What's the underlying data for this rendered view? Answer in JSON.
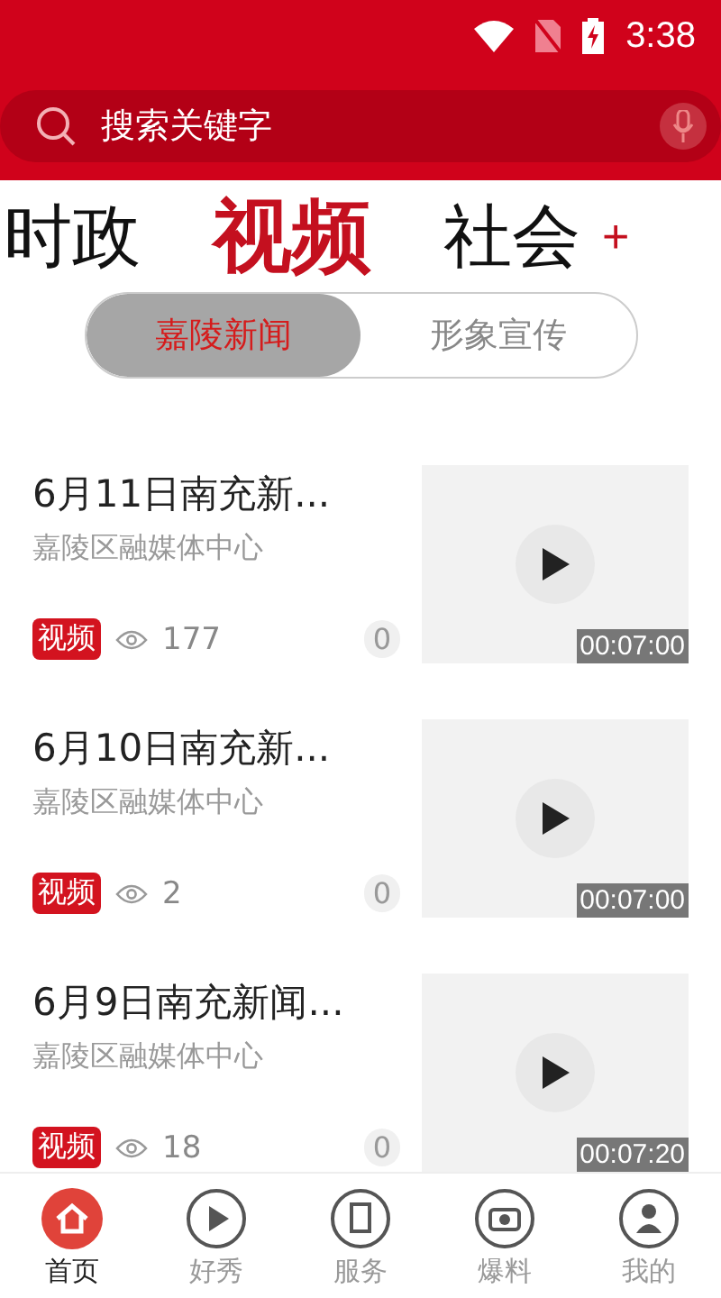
{
  "status_bar": {
    "time": "3:38"
  },
  "search": {
    "placeholder": "搜索关键字"
  },
  "channels": [
    {
      "label": "时政",
      "selected": false
    },
    {
      "label": "视频",
      "selected": true
    },
    {
      "label": "社会",
      "selected": false
    }
  ],
  "add_channel": "+",
  "segments": [
    {
      "label": "嘉陵新闻",
      "selected": true
    },
    {
      "label": "形象宣传",
      "selected": false
    }
  ],
  "articles": [
    {
      "title": "6月11日南充新...",
      "source": "嘉陵区融媒体中心",
      "tag": "视频",
      "views": "177",
      "comments": "0",
      "duration": "00:07:00"
    },
    {
      "title": "6月10日南充新...",
      "source": "嘉陵区融媒体中心",
      "tag": "视频",
      "views": "2",
      "comments": "0",
      "duration": "00:07:00"
    },
    {
      "title": "6月9日南充新闻...",
      "source": "嘉陵区融媒体中心",
      "tag": "视频",
      "views": "18",
      "comments": "0",
      "duration": "00:07:20"
    }
  ],
  "bottom_nav": [
    {
      "label": "首页",
      "selected": true,
      "kind": "home"
    },
    {
      "label": "好秀",
      "selected": false,
      "kind": "play"
    },
    {
      "label": "服务",
      "selected": false,
      "kind": "service"
    },
    {
      "label": "爆料",
      "selected": false,
      "kind": "report"
    },
    {
      "label": "我的",
      "selected": false,
      "kind": "user"
    }
  ]
}
